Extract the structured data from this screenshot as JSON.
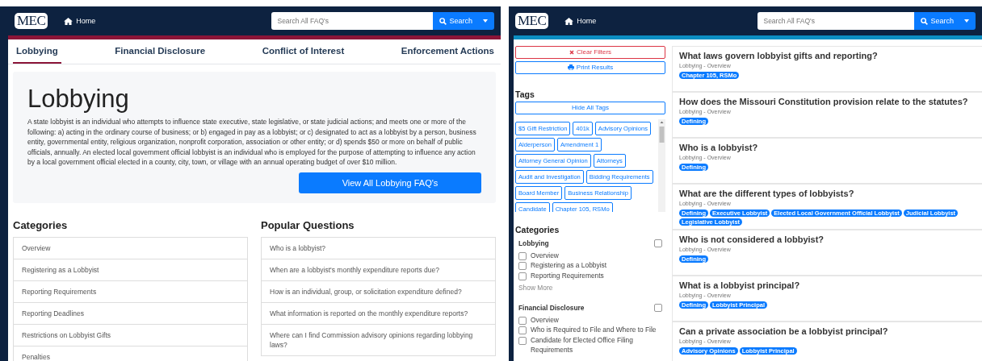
{
  "left": {
    "header": {
      "logo": "MEC",
      "home": "Home",
      "search_placeholder": "Search All FAQ's",
      "search_button": "Search"
    },
    "tabs": [
      {
        "label": "Lobbying",
        "selected": true
      },
      {
        "label": "Financial Disclosure",
        "selected": false
      },
      {
        "label": "Conflict of Interest",
        "selected": false
      },
      {
        "label": "Enforcement Actions",
        "selected": false
      }
    ],
    "hero": {
      "title": "Lobbying",
      "text": "A state lobbyist is an individual who attempts to influence state executive, state legislative, or state judicial actions; and meets one or more of the following: a) acting in the ordinary course of business; or b) engaged in pay as a lobbyist; or c) designated to act as a lobbyist by a person, business entity, governmental entity, religious organization, nonprofit corporation, association or other entity; or d) spends $50 or more on behalf of public officials, annually. An elected local government official lobbyist is an individual who is employed for the purpose of attempting to influence any action by a local government official elected in a county, city, town, or village with an annual operating budget of over $10 million.",
      "button": "View All Lobbying FAQ's"
    },
    "categories": {
      "title": "Categories",
      "items": [
        "Overview",
        "Registering as a Lobbyist",
        "Reporting Requirements",
        "Reporting Deadlines",
        "Restrictions on Lobbyist Gifts",
        "Penalties"
      ]
    },
    "popular": {
      "title": "Popular Questions",
      "items": [
        "Who is a lobbyist?",
        "When are a lobbyist's monthly expenditure reports due?",
        "How is an individual, group, or solicitation expenditure defined?",
        "What information is reported on the monthly expenditure reports?",
        "Where can I find Commission advisory opinions regarding lobbying laws?"
      ]
    }
  },
  "right": {
    "header": {
      "logo": "MEC",
      "home": "Home",
      "search_placeholder": "Search All FAQ's",
      "search_button": "Search"
    },
    "clear_filters": "Clear Filters",
    "print_results": "Print Results",
    "tags_title": "Tags",
    "hide_tags": "Hide All Tags",
    "tags": [
      "$5 Gift Restriction",
      "401k",
      "Advisory Opinions",
      "Alderperson",
      "Amendment 1",
      "Attorney General Opinion",
      "Attorneys",
      "Audit and Investigation",
      "Bidding Requirements",
      "Board Member",
      "Business Relationship",
      "Candidate",
      "Chapter 105, RSMo"
    ],
    "categories_title": "Categories",
    "groups": [
      {
        "name": "Lobbying",
        "checked": false,
        "items": [
          {
            "label": "Overview",
            "checked": false
          },
          {
            "label": "Registering as a Lobbyist",
            "checked": false
          },
          {
            "label": "Reporting Requirements",
            "checked": false
          }
        ],
        "more": "Show More"
      },
      {
        "name": "Financial Disclosure",
        "checked": false,
        "items": [
          {
            "label": "Overview",
            "checked": false
          },
          {
            "label": "Who is Required to File and Where to File",
            "checked": false
          },
          {
            "label": "Candidate for Elected Office Filing Requirements",
            "checked": false
          }
        ]
      }
    ],
    "questions": [
      {
        "title": "What laws govern lobbyist gifts and reporting?",
        "category": "Lobbying - Overview",
        "tags": [
          "Chapter 105, RSMo"
        ]
      },
      {
        "title": "How does the Missouri Constitution provision relate to the statutes?",
        "category": "Lobbying - Overview",
        "tags": [
          "Defining"
        ]
      },
      {
        "title": "Who is a lobbyist?",
        "category": "Lobbying - Overview",
        "tags": [
          "Defining"
        ]
      },
      {
        "title": "What are the different types of lobbyists?",
        "category": "Lobbying - Overview",
        "tags": [
          "Defining",
          "Executive Lobbyist",
          "Elected Local Government Official Lobbyist",
          "Judicial Lobbyist",
          "Legislative Lobbyist"
        ]
      },
      {
        "title": "Who is not considered a lobbyist?",
        "category": "Lobbying - Overview",
        "tags": [
          "Defining"
        ]
      },
      {
        "title": "What is a lobbyist principal?",
        "category": "Lobbying - Overview",
        "tags": [
          "Defining",
          "Lobbyist Principal"
        ]
      },
      {
        "title": "Can a private association be a lobbyist principal?",
        "category": "Lobbying - Overview",
        "tags": [
          "Advisory Opinions",
          "Lobbyist Principal"
        ]
      }
    ]
  }
}
